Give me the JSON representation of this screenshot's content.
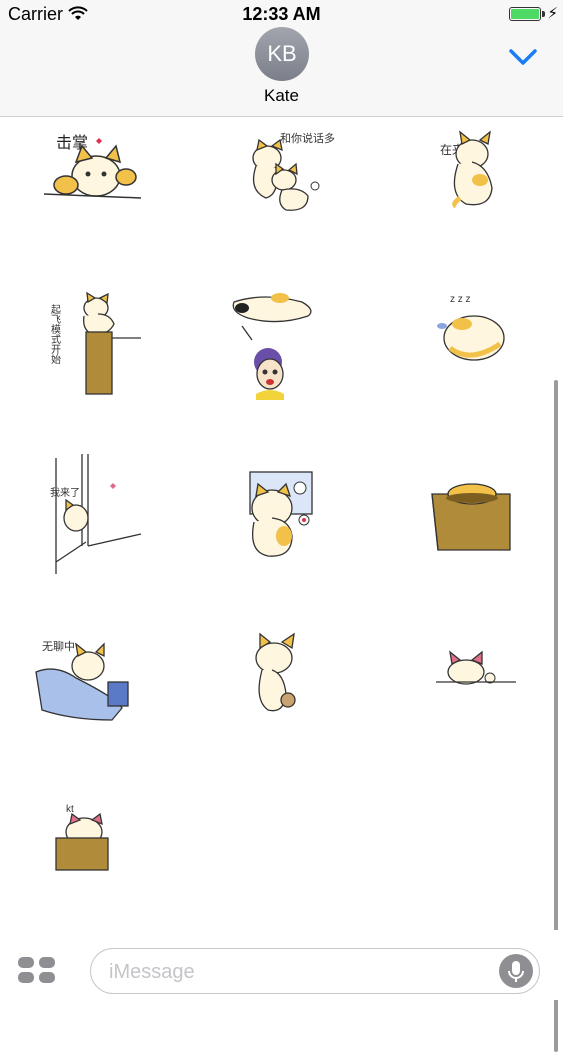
{
  "status_bar": {
    "carrier": "Carrier",
    "time": "12:33 AM",
    "battery_level_percent": 100
  },
  "header": {
    "avatar_initials": "KB",
    "contact_name": "Kate"
  },
  "stickers": {
    "clap_text": "击掌",
    "chat_text": "和你说话多",
    "alone_text": "在来了",
    "takeoff_text": "起飞模式开始",
    "peek_text": "我来了",
    "bored_text": "无聊中",
    "box_text": "kt"
  },
  "input": {
    "placeholder": "iMessage"
  },
  "colors": {
    "accent": "#1a7cf5",
    "cat_yellow": "#f2c14a",
    "box_brown": "#b08b3a"
  }
}
